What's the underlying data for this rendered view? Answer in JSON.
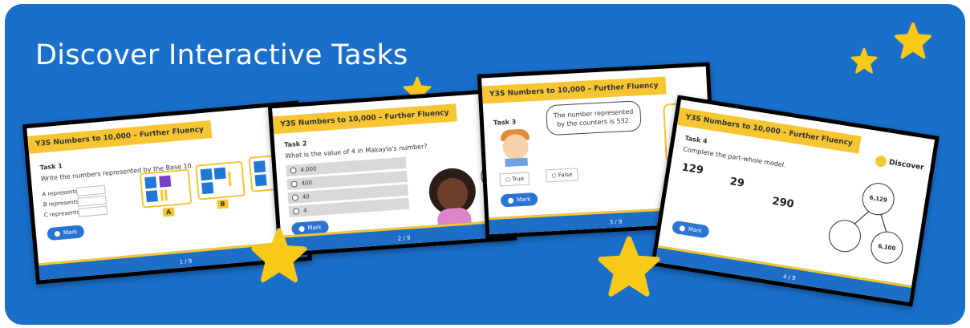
{
  "banner": {
    "title": "Discover Interactive Tasks",
    "bg_color": "#1a6fcb",
    "star_color": "#f9c91a"
  },
  "slide1": {
    "tag": "Y3S Numbers to 10,000 – Further Fluency",
    "task": "Task 1",
    "instruction": "Write the numbers represented by the Base 10.",
    "rows": [
      "A represents",
      "B represents",
      "C represents"
    ],
    "labels": [
      "A",
      "B"
    ],
    "button": "Mark",
    "pager": "1 / 9"
  },
  "slide2": {
    "tag": "Y3S Numbers to 10,000 – Further Fluency",
    "task": "Task 2",
    "question": "What is the value of 4 in Makayla's number?",
    "options": [
      "4,000",
      "400",
      "40",
      "4"
    ],
    "button": "Mark",
    "pager": "2 / 9"
  },
  "slide3": {
    "tag": "Y3S Numbers to 10,000 – Further Fluency",
    "task": "Task 3",
    "speech": "The number represented by the counters is 532.",
    "true_label": "True",
    "false_label": "False",
    "button": "Mark",
    "pager": "3 / 9",
    "logo": "Discover"
  },
  "slide4": {
    "tag": "Y3S Numbers to 10,000 – Further Fluency",
    "task": "Task 4",
    "instruction": "Complete the part-whole model.",
    "numbers": [
      "129",
      "29",
      "290"
    ],
    "whole": "6,129",
    "part": "6,100",
    "button": "Mark",
    "pager": "4 / 9",
    "logo": "Discover"
  }
}
